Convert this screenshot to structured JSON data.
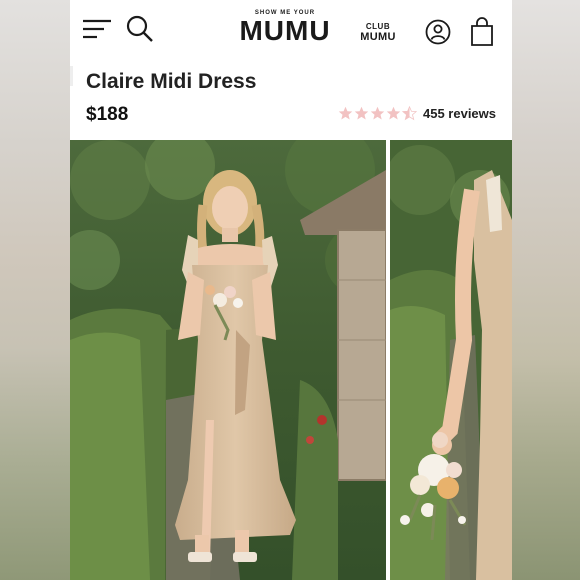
{
  "header": {
    "logo_tagline": "SHOW ME YOUR",
    "logo_word": "MUMU",
    "club_top": "CLUB",
    "club_bottom": "MUMU",
    "icons": [
      "menu-icon",
      "search-icon",
      "account-icon",
      "shopping-bag-icon"
    ]
  },
  "product": {
    "title": "Claire Midi Dress",
    "price": "$188",
    "rating": 4.5,
    "rating_max": 5,
    "reviews": "455 reviews"
  },
  "gallery": {
    "images": [
      "main-product-photo",
      "secondary-product-photo"
    ]
  },
  "colors": {
    "star": "#f2c2c2",
    "text": "#1a1a1a",
    "dress": "#dcc3a3"
  }
}
